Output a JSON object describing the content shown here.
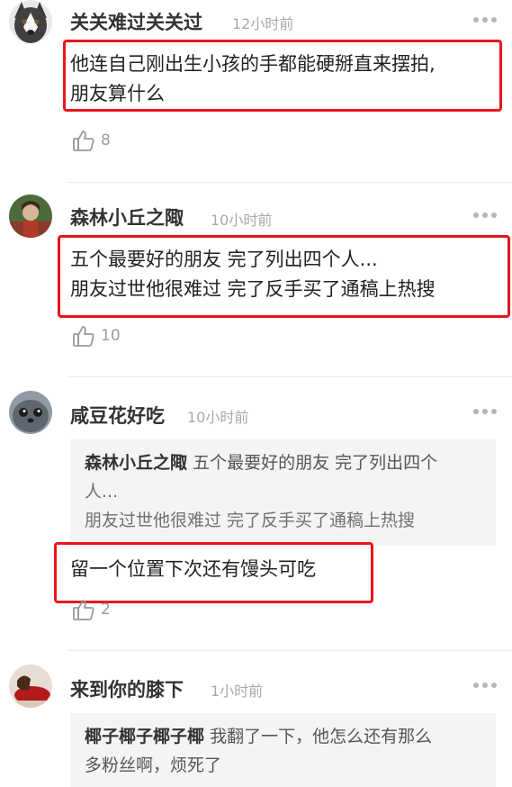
{
  "comments": [
    {
      "username": "关关难过关关过",
      "time": "12小时前",
      "avatar": "husky-dog-avatar",
      "text_lines": [
        "他连自己刚出生小孩的手都能硬掰直来摆拍,",
        "朋友算什么"
      ],
      "likes": "8"
    },
    {
      "username": "森林小丘之陬",
      "time": "10小时前",
      "avatar": "person-in-forest-avatar",
      "text_lines": [
        "五个最要好的朋友 完了列出四个人...",
        "朋友过世他很难过 完了反手买了通稿上热搜"
      ],
      "likes": "10"
    },
    {
      "username": "咸豆花好吃",
      "time": "10小时前",
      "avatar": "seal-avatar",
      "quote": {
        "user": "森林小丘之陬",
        "line1": "五个最要好的朋友 完了列出四个",
        "line2": "人...",
        "line3": "朋友过世他很难过 完了反手买了通稿上热搜"
      },
      "text_lines": [
        "留一个位置下次还有馒头可吃"
      ],
      "likes": "2"
    },
    {
      "username": "来到你的膝下",
      "time": "1小时前",
      "avatar": "woman-reclining-avatar",
      "quote": {
        "user": "椰子椰子椰子椰",
        "line1": "我翻了一下，他怎么还有那么",
        "line2": "多粉丝啊，烦死了"
      }
    }
  ],
  "icons": {
    "like": "thumbs-up-icon",
    "more": "more-dots-icon"
  },
  "colors": {
    "highlight": "#e8141b",
    "muted": "#a8a8a8"
  }
}
